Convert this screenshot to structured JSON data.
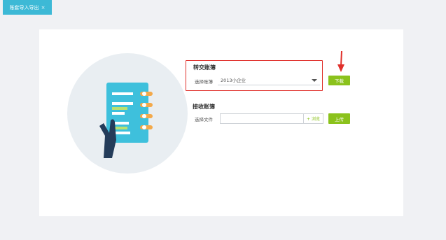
{
  "tab": {
    "label": "账套导入导出",
    "close": "×"
  },
  "export_section": {
    "title": "转交账簿",
    "select_label": "选择账簿",
    "selected_value": "2013小企业",
    "download_label": "下载"
  },
  "import_section": {
    "title": "接收账簿",
    "file_label": "选择文件",
    "browse_label": "+ 浏览",
    "upload_label": "上传"
  },
  "colors": {
    "accent": "#3db9d6",
    "button": "#8bc21c",
    "highlight": "#e0302b"
  }
}
